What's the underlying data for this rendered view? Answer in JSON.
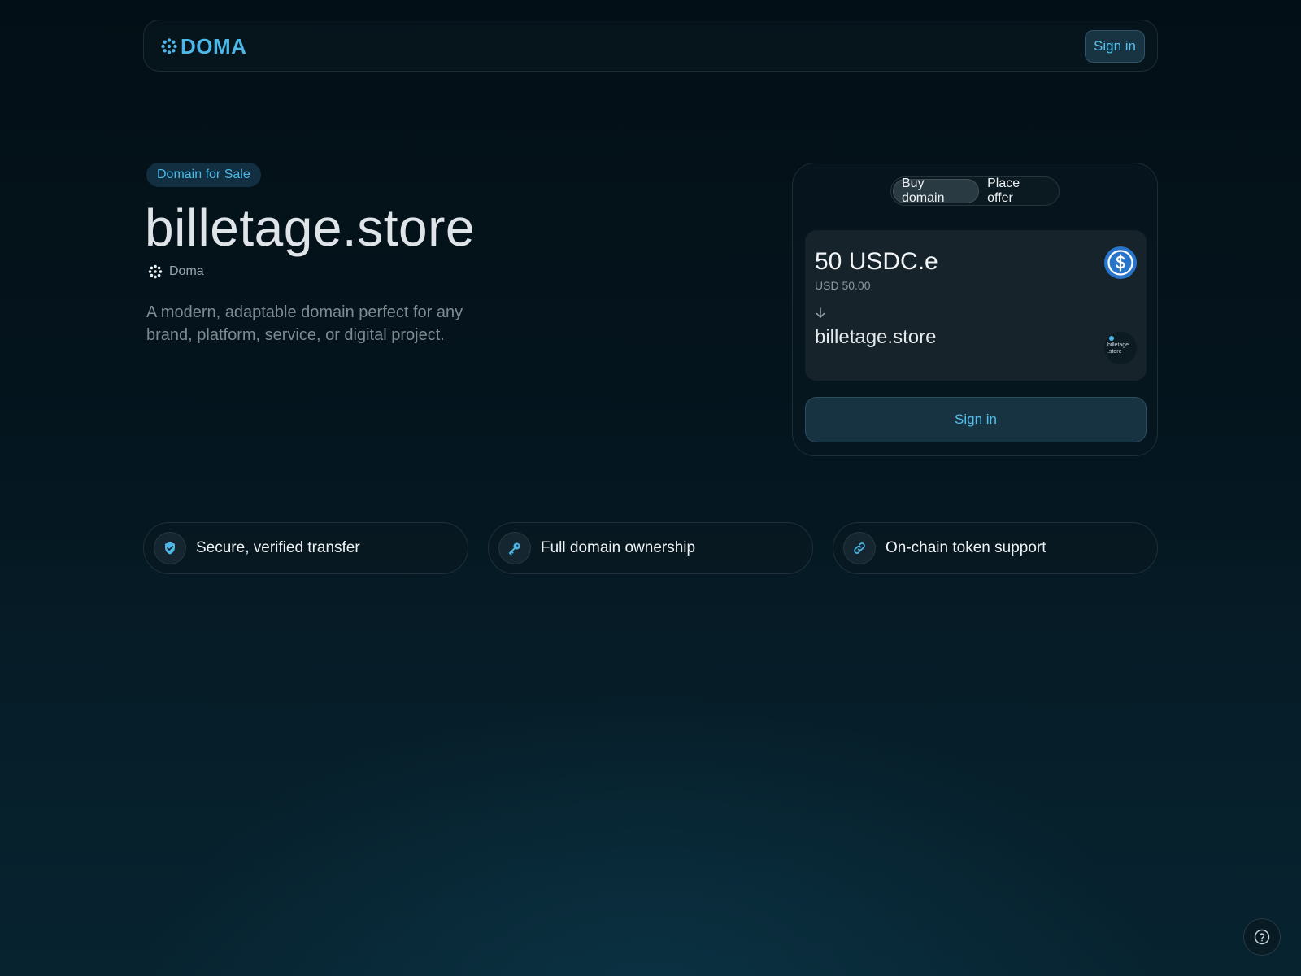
{
  "header": {
    "logo_text": "DOMA",
    "signin_label": "Sign in"
  },
  "hero": {
    "badge": "Domain for Sale",
    "domain": "billetage.store",
    "registrar": "Doma",
    "description": "A modern, adaptable domain perfect for any brand, platform, service, or digital project."
  },
  "purchase": {
    "tabs": [
      {
        "label": "Buy domain",
        "active": true
      },
      {
        "label": "Place offer",
        "active": false
      }
    ],
    "price": "50 USDC.e",
    "price_usd": "USD 50.00",
    "token_icon": "usdc-icon",
    "domain": "billetage.store",
    "thumb_text_line1": "billetage",
    "thumb_text_line2": ".store",
    "signin_label": "Sign in"
  },
  "features": [
    {
      "label": "Secure, verified transfer",
      "icon": "shield-check-icon"
    },
    {
      "label": "Full domain ownership",
      "icon": "key-icon"
    },
    {
      "label": "On-chain token support",
      "icon": "link-icon"
    }
  ],
  "help": {
    "icon": "question-circle-icon"
  },
  "colors": {
    "accent": "#4db8e8",
    "background": "#04141d",
    "usdc_blue": "#2775ca"
  }
}
